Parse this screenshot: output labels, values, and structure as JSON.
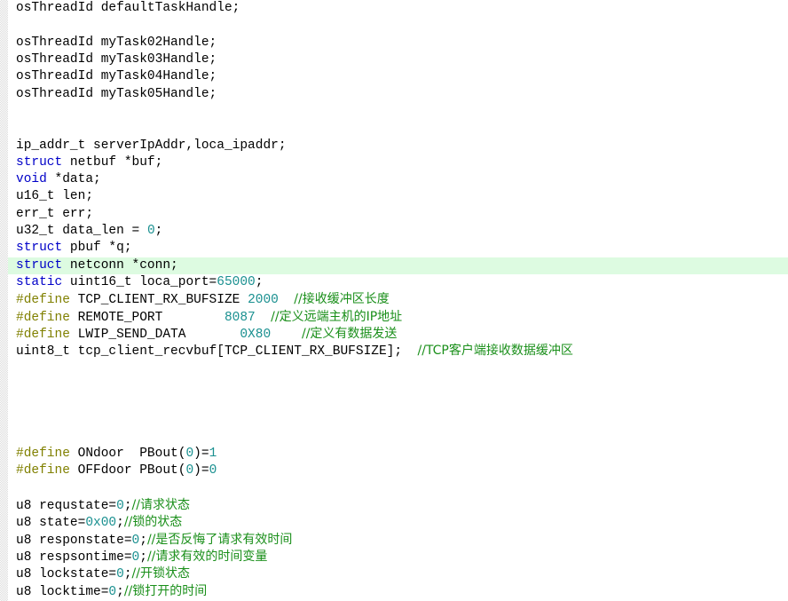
{
  "editor": {
    "name": "source-code-view",
    "language": "c",
    "background_color": "#ffffff",
    "text_color": "#000000",
    "current_line_highlight_color": "#ddfbe1",
    "gutter_color": "#dcdcdc",
    "current_line_index": 15,
    "colors": {
      "keyword": "#0000C8",
      "preprocessor": "#808000",
      "number": "#1a9090",
      "comment": "#1a8f1a"
    }
  },
  "lines": [
    {
      "n": 0,
      "segments": [
        {
          "t": "osThreadId defaultTaskHandle;",
          "c": "plain"
        }
      ]
    },
    {
      "n": 1,
      "segments": []
    },
    {
      "n": 2,
      "segments": [
        {
          "t": "osThreadId myTask02Handle;",
          "c": "plain"
        }
      ]
    },
    {
      "n": 3,
      "segments": [
        {
          "t": "osThreadId myTask03Handle;",
          "c": "plain"
        }
      ]
    },
    {
      "n": 4,
      "segments": [
        {
          "t": "osThreadId myTask04Handle;",
          "c": "plain"
        }
      ]
    },
    {
      "n": 5,
      "segments": [
        {
          "t": "osThreadId myTask05Handle;",
          "c": "plain"
        }
      ]
    },
    {
      "n": 6,
      "segments": []
    },
    {
      "n": 7,
      "segments": []
    },
    {
      "n": 8,
      "segments": [
        {
          "t": "ip_addr_t serverIpAddr,loca_ipaddr;",
          "c": "plain"
        }
      ]
    },
    {
      "n": 9,
      "segments": [
        {
          "t": "struct",
          "c": "kw"
        },
        {
          "t": " netbuf *buf;",
          "c": "plain"
        }
      ]
    },
    {
      "n": 10,
      "segments": [
        {
          "t": "void",
          "c": "kw"
        },
        {
          "t": " *data;",
          "c": "plain"
        }
      ]
    },
    {
      "n": 11,
      "segments": [
        {
          "t": "u16_t len;",
          "c": "plain"
        }
      ]
    },
    {
      "n": 12,
      "segments": [
        {
          "t": "err_t err;",
          "c": "plain"
        }
      ]
    },
    {
      "n": 13,
      "segments": [
        {
          "t": "u32_t data_len = ",
          "c": "plain"
        },
        {
          "t": "0",
          "c": "num"
        },
        {
          "t": ";",
          "c": "plain"
        }
      ]
    },
    {
      "n": 14,
      "segments": [
        {
          "t": "struct",
          "c": "kw"
        },
        {
          "t": " pbuf *q;",
          "c": "plain"
        }
      ]
    },
    {
      "n": 15,
      "segments": [
        {
          "t": "struct",
          "c": "kw"
        },
        {
          "t": " netconn *conn;",
          "c": "plain"
        }
      ]
    },
    {
      "n": 16,
      "segments": [
        {
          "t": "static",
          "c": "kw"
        },
        {
          "t": " uint16_t loca_port=",
          "c": "plain"
        },
        {
          "t": "65000",
          "c": "num"
        },
        {
          "t": ";",
          "c": "plain"
        }
      ]
    },
    {
      "n": 17,
      "segments": [
        {
          "t": "#define",
          "c": "pp"
        },
        {
          "t": " TCP_CLIENT_RX_BUFSIZE ",
          "c": "plain"
        },
        {
          "t": "2000",
          "c": "num"
        },
        {
          "t": "  ",
          "c": "plain"
        },
        {
          "t": "//接收缓冲区长度",
          "c": "cmt"
        }
      ]
    },
    {
      "n": 18,
      "segments": [
        {
          "t": "#define",
          "c": "pp"
        },
        {
          "t": " REMOTE_PORT        ",
          "c": "plain"
        },
        {
          "t": "8087",
          "c": "num"
        },
        {
          "t": "  ",
          "c": "plain"
        },
        {
          "t": "//定义远端主机的IP地址",
          "c": "cmt"
        }
      ]
    },
    {
      "n": 19,
      "segments": [
        {
          "t": "#define",
          "c": "pp"
        },
        {
          "t": " LWIP_SEND_DATA       ",
          "c": "plain"
        },
        {
          "t": "0X80",
          "c": "num"
        },
        {
          "t": "    ",
          "c": "plain"
        },
        {
          "t": "//定义有数据发送",
          "c": "cmt"
        }
      ]
    },
    {
      "n": 20,
      "segments": [
        {
          "t": "uint8_t tcp_client_recvbuf[TCP_CLIENT_RX_BUFSIZE];  ",
          "c": "plain"
        },
        {
          "t": "//TCP客户端接收数据缓冲区",
          "c": "cmt"
        }
      ]
    },
    {
      "n": 21,
      "segments": []
    },
    {
      "n": 22,
      "segments": []
    },
    {
      "n": 23,
      "segments": []
    },
    {
      "n": 24,
      "segments": []
    },
    {
      "n": 25,
      "segments": []
    },
    {
      "n": 26,
      "segments": [
        {
          "t": "#define",
          "c": "pp"
        },
        {
          "t": " ONdoor  PBout(",
          "c": "plain"
        },
        {
          "t": "0",
          "c": "num"
        },
        {
          "t": ")=",
          "c": "plain"
        },
        {
          "t": "1",
          "c": "num"
        }
      ]
    },
    {
      "n": 27,
      "segments": [
        {
          "t": "#define",
          "c": "pp"
        },
        {
          "t": " OFFdoor PBout(",
          "c": "plain"
        },
        {
          "t": "0",
          "c": "num"
        },
        {
          "t": ")=",
          "c": "plain"
        },
        {
          "t": "0",
          "c": "num"
        }
      ]
    },
    {
      "n": 28,
      "segments": []
    },
    {
      "n": 29,
      "segments": [
        {
          "t": "u8 requstate=",
          "c": "plain"
        },
        {
          "t": "0",
          "c": "num"
        },
        {
          "t": ";",
          "c": "plain"
        },
        {
          "t": "//请求状态",
          "c": "cmt"
        }
      ]
    },
    {
      "n": 30,
      "segments": [
        {
          "t": "u8 state=",
          "c": "plain"
        },
        {
          "t": "0x00",
          "c": "num"
        },
        {
          "t": ";",
          "c": "plain"
        },
        {
          "t": "//锁的状态",
          "c": "cmt"
        }
      ]
    },
    {
      "n": 31,
      "segments": [
        {
          "t": "u8 responstate=",
          "c": "plain"
        },
        {
          "t": "0",
          "c": "num"
        },
        {
          "t": ";",
          "c": "plain"
        },
        {
          "t": "//是否反悔了请求有效时间",
          "c": "cmt"
        }
      ]
    },
    {
      "n": 32,
      "segments": [
        {
          "t": "u8 respsontime=",
          "c": "plain"
        },
        {
          "t": "0",
          "c": "num"
        },
        {
          "t": ";",
          "c": "plain"
        },
        {
          "t": "//请求有效的时间变量",
          "c": "cmt"
        }
      ]
    },
    {
      "n": 33,
      "segments": [
        {
          "t": "u8 lockstate=",
          "c": "plain"
        },
        {
          "t": "0",
          "c": "num"
        },
        {
          "t": ";",
          "c": "plain"
        },
        {
          "t": "//开锁状态",
          "c": "cmt"
        }
      ]
    },
    {
      "n": 34,
      "segments": [
        {
          "t": "u8 locktime=",
          "c": "plain"
        },
        {
          "t": "0",
          "c": "num"
        },
        {
          "t": ";",
          "c": "plain"
        },
        {
          "t": "//锁打开的时间",
          "c": "cmt"
        }
      ]
    }
  ]
}
